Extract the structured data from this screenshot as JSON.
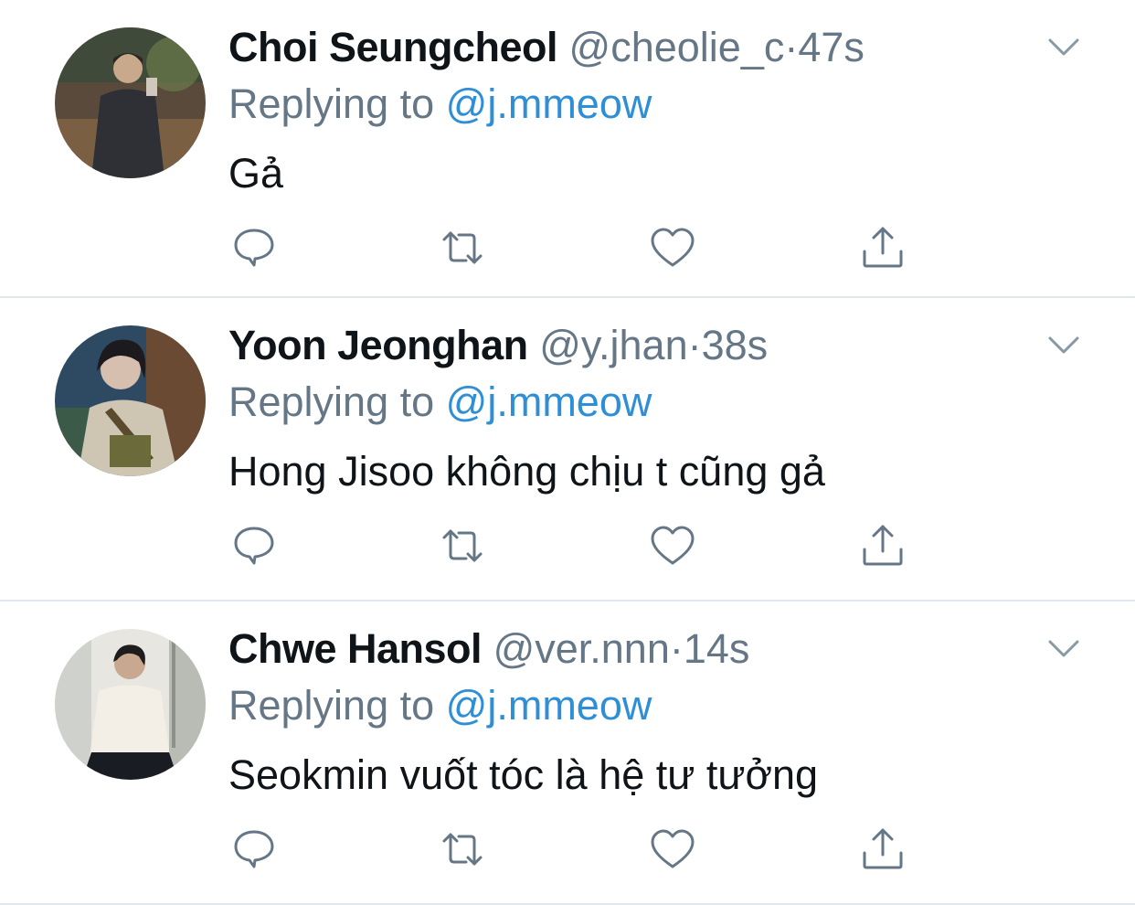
{
  "colors": {
    "text": "#0f1419",
    "secondary": "#657786",
    "mention": "#2f8fd6",
    "divider": "#e1e8ed",
    "icon": "#657786"
  },
  "tweets": [
    {
      "name": "Choi Seungcheol",
      "handle": "@cheolie_c",
      "separator": "·",
      "time": "47s",
      "replying_prefix": "Replying to",
      "replying_to": "@j.mmeow",
      "text": "Gả",
      "avatar_icon": "avatar-photo"
    },
    {
      "name": "Yoon Jeonghan",
      "handle": "@y.jhan",
      "separator": "·",
      "time": "38s",
      "replying_prefix": "Replying to",
      "replying_to": "@j.mmeow",
      "text": "Hong Jisoo không chịu t cũng gả",
      "avatar_icon": "avatar-photo"
    },
    {
      "name": "Chwe Hansol",
      "handle": "@ver.nnn",
      "separator": "·",
      "time": "14s",
      "replying_prefix": "Replying to",
      "replying_to": "@j.mmeow",
      "text": "Seokmin vuốt tóc là hệ tư tưởng",
      "avatar_icon": "avatar-photo"
    }
  ],
  "action_icons": [
    "reply-icon",
    "retweet-icon",
    "like-icon",
    "share-icon"
  ]
}
